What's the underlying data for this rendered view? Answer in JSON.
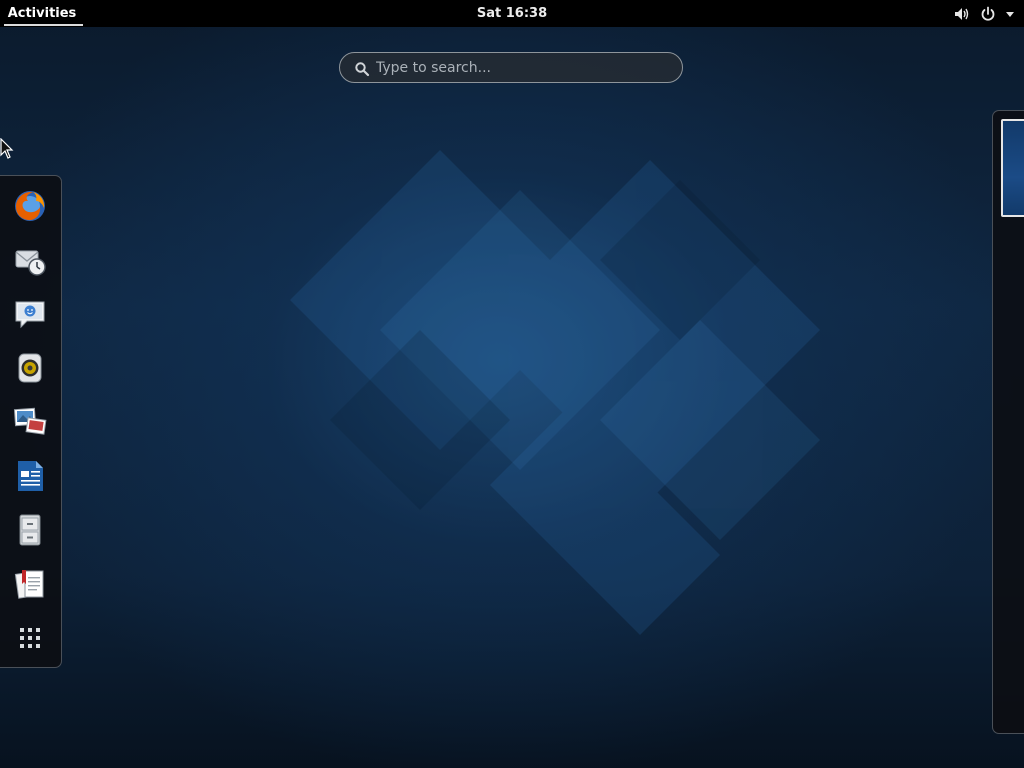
{
  "topbar": {
    "activities_label": "Activities",
    "clock": "Sat 16:38",
    "tray": {
      "volume_icon": "volume-icon",
      "power_icon": "power-icon",
      "menu_arrow_icon": "dropdown-arrow-icon"
    }
  },
  "search": {
    "placeholder": "Type to search...",
    "value": "",
    "icon": "search-icon"
  },
  "dash": {
    "items": [
      {
        "name": "firefox",
        "icon": "firefox-icon"
      },
      {
        "name": "evolution",
        "icon": "mail-clock-icon"
      },
      {
        "name": "empathy",
        "icon": "chat-bubble-icon"
      },
      {
        "name": "rhythmbox",
        "icon": "speaker-icon"
      },
      {
        "name": "shotwell",
        "icon": "photos-icon"
      },
      {
        "name": "libreoffice-writer",
        "icon": "document-icon"
      },
      {
        "name": "files",
        "icon": "file-cabinet-icon"
      },
      {
        "name": "document-viewer",
        "icon": "documents-icon"
      }
    ],
    "show_apps_icon": "grid-icon"
  },
  "workspaces": {
    "active_index": 0
  },
  "colors": {
    "topbar_bg": "#000000",
    "dash_bg": "#0c0e12",
    "wallpaper_accent": "#1c4a78",
    "firefox_orange": "#e66000",
    "writer_blue": "#1f5fa8"
  }
}
